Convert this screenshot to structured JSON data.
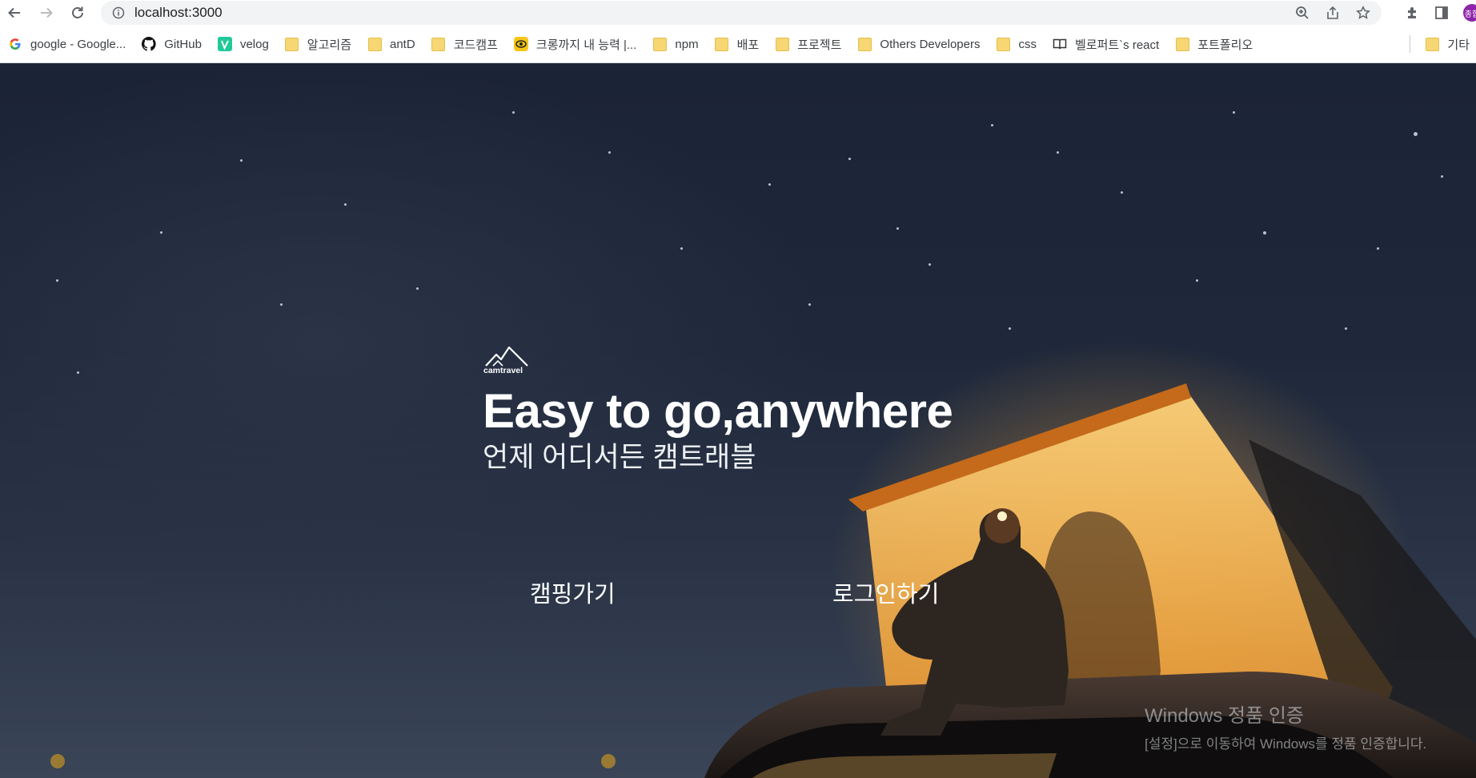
{
  "browser": {
    "url": "localhost:3000",
    "profile_initial": "종합"
  },
  "bookmarks": [
    {
      "label": "google - Google...",
      "icon": "google-icon"
    },
    {
      "label": "GitHub",
      "icon": "github-icon"
    },
    {
      "label": "velog",
      "icon": "velog-icon"
    },
    {
      "label": "알고리즘",
      "icon": "folder-icon"
    },
    {
      "label": "antD",
      "icon": "folder-icon"
    },
    {
      "label": "코드캠프",
      "icon": "folder-icon"
    },
    {
      "label": "크롱까지 내 능력 |...",
      "icon": "eye-icon"
    },
    {
      "label": "npm",
      "icon": "folder-icon"
    },
    {
      "label": "배포",
      "icon": "folder-icon"
    },
    {
      "label": "프로젝트",
      "icon": "folder-icon"
    },
    {
      "label": "Others Developers",
      "icon": "folder-icon"
    },
    {
      "label": "css",
      "icon": "folder-icon"
    },
    {
      "label": "벨로퍼트`s react",
      "icon": "book-icon"
    },
    {
      "label": "포트폴리오",
      "icon": "folder-icon"
    }
  ],
  "other_bookmarks": "기타",
  "hero": {
    "logo_text": "camtravel",
    "headline": "Easy to go,anywhere",
    "subline": "언제 어디서든 캠트래블",
    "camping_button": "캠핑가기",
    "login_button": "로그인하기"
  },
  "watermark": {
    "title": "Windows 정품 인증",
    "subtitle": "[설정]으로 이동하여 Windows를 정품 인증합니다."
  }
}
